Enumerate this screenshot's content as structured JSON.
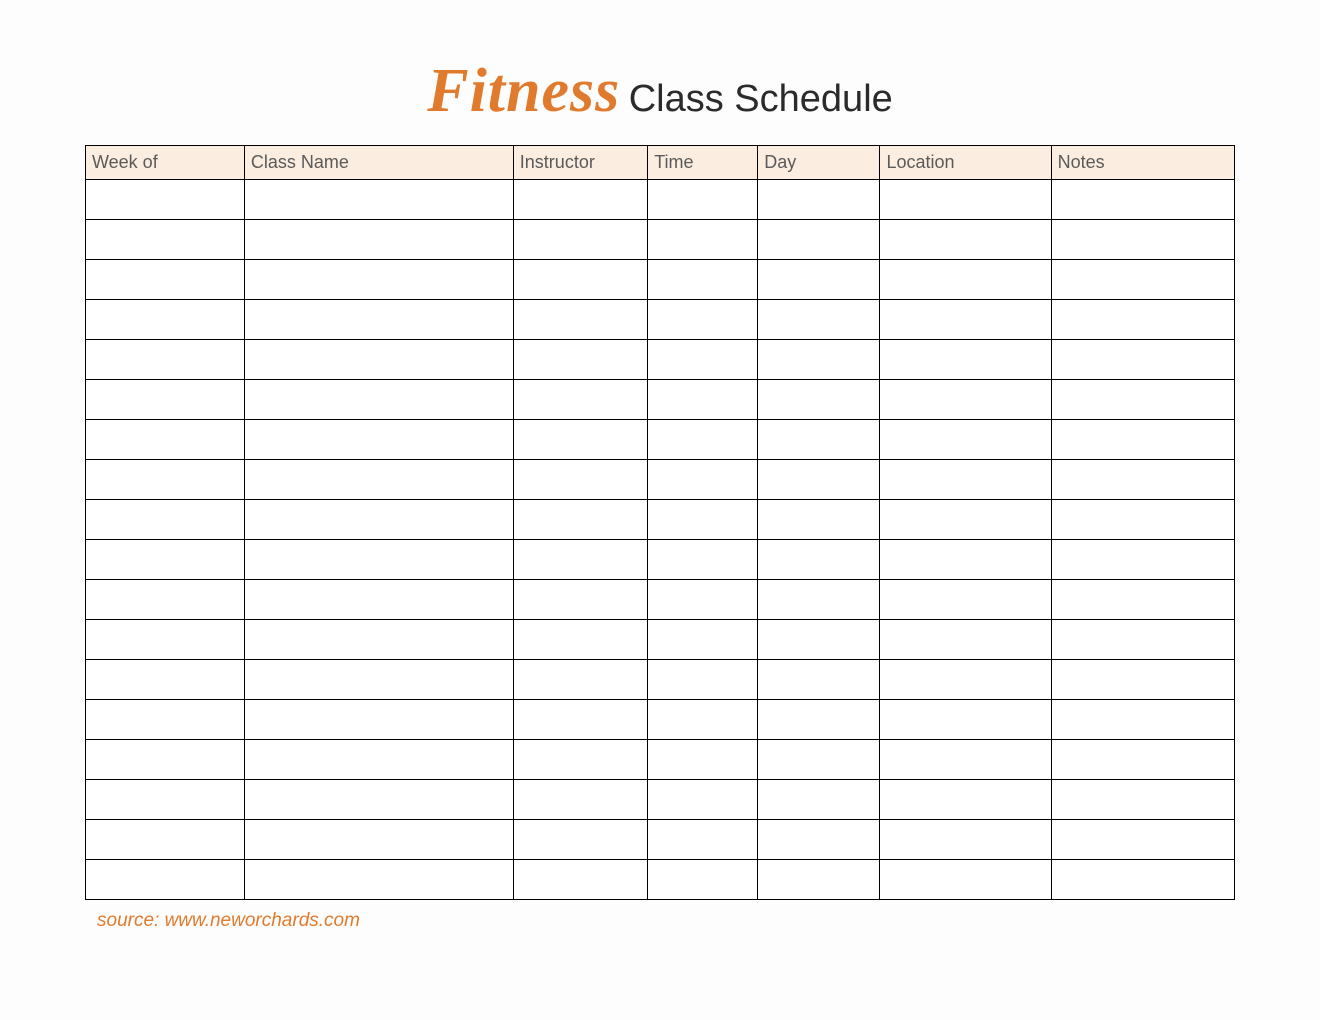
{
  "title": {
    "accent": "Fitness",
    "main": "Class Schedule"
  },
  "headers": {
    "week": "Week of",
    "class_name": "Class Name",
    "instructor": "Instructor",
    "time": "Time",
    "day": "Day",
    "location": "Location",
    "notes": "Notes"
  },
  "rows": [
    {
      "week": "",
      "class_name": "",
      "instructor": "",
      "time": "",
      "day": "",
      "location": "",
      "notes": ""
    },
    {
      "week": "",
      "class_name": "",
      "instructor": "",
      "time": "",
      "day": "",
      "location": "",
      "notes": ""
    },
    {
      "week": "",
      "class_name": "",
      "instructor": "",
      "time": "",
      "day": "",
      "location": "",
      "notes": ""
    },
    {
      "week": "",
      "class_name": "",
      "instructor": "",
      "time": "",
      "day": "",
      "location": "",
      "notes": ""
    },
    {
      "week": "",
      "class_name": "",
      "instructor": "",
      "time": "",
      "day": "",
      "location": "",
      "notes": ""
    },
    {
      "week": "",
      "class_name": "",
      "instructor": "",
      "time": "",
      "day": "",
      "location": "",
      "notes": ""
    },
    {
      "week": "",
      "class_name": "",
      "instructor": "",
      "time": "",
      "day": "",
      "location": "",
      "notes": ""
    },
    {
      "week": "",
      "class_name": "",
      "instructor": "",
      "time": "",
      "day": "",
      "location": "",
      "notes": ""
    },
    {
      "week": "",
      "class_name": "",
      "instructor": "",
      "time": "",
      "day": "",
      "location": "",
      "notes": ""
    },
    {
      "week": "",
      "class_name": "",
      "instructor": "",
      "time": "",
      "day": "",
      "location": "",
      "notes": ""
    },
    {
      "week": "",
      "class_name": "",
      "instructor": "",
      "time": "",
      "day": "",
      "location": "",
      "notes": ""
    },
    {
      "week": "",
      "class_name": "",
      "instructor": "",
      "time": "",
      "day": "",
      "location": "",
      "notes": ""
    },
    {
      "week": "",
      "class_name": "",
      "instructor": "",
      "time": "",
      "day": "",
      "location": "",
      "notes": ""
    },
    {
      "week": "",
      "class_name": "",
      "instructor": "",
      "time": "",
      "day": "",
      "location": "",
      "notes": ""
    },
    {
      "week": "",
      "class_name": "",
      "instructor": "",
      "time": "",
      "day": "",
      "location": "",
      "notes": ""
    },
    {
      "week": "",
      "class_name": "",
      "instructor": "",
      "time": "",
      "day": "",
      "location": "",
      "notes": ""
    },
    {
      "week": "",
      "class_name": "",
      "instructor": "",
      "time": "",
      "day": "",
      "location": "",
      "notes": ""
    },
    {
      "week": "",
      "class_name": "",
      "instructor": "",
      "time": "",
      "day": "",
      "location": "",
      "notes": ""
    }
  ],
  "source": "source: www.neworchards.com"
}
